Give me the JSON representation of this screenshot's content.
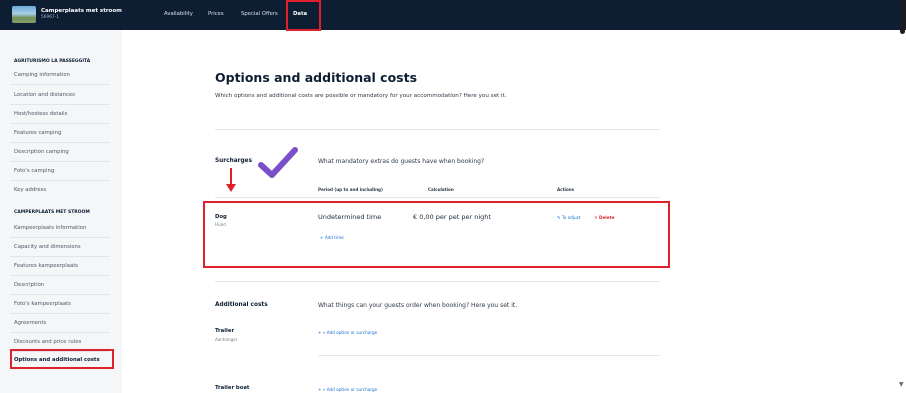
{
  "header": {
    "property_name": "Camperplaats met stroom",
    "property_id": "56967-1",
    "nav": [
      {
        "label": "Availability"
      },
      {
        "label": "Prices"
      },
      {
        "label": "Special Offers"
      },
      {
        "label": "Data",
        "active": true
      }
    ]
  },
  "sidebar": {
    "group1_title": "AGRITURISMO LA PASSEGGITA",
    "group1_items": [
      {
        "label": "Camping information"
      },
      {
        "label": "Location and distances"
      },
      {
        "label": "Host/hostess details"
      },
      {
        "label": "Features camping"
      },
      {
        "label": "Description camping"
      },
      {
        "label": "Foto's camping"
      },
      {
        "label": "Key address"
      }
    ],
    "group2_title": "CAMPERPLAATS MET STROOM",
    "group2_items": [
      {
        "label": "Kampeerplaats information"
      },
      {
        "label": "Capacity and dimensions"
      },
      {
        "label": "Features kampeerplaats"
      },
      {
        "label": "Description"
      },
      {
        "label": "Foto's kampeerplaats"
      },
      {
        "label": "Agreements"
      },
      {
        "label": "Discounts and price rules"
      },
      {
        "label": "Options and additional costs",
        "active": true
      }
    ]
  },
  "main": {
    "title": "Options and additional costs",
    "description": "Which options and additional costs are possible or mandatory for your accommodation? Here you set it.",
    "surcharges": {
      "title": "Surcharges",
      "question": "What mandatory extras do guests have when booking?",
      "columns": [
        "Period (up to and including)",
        "Calculation",
        "Actions"
      ],
      "rows": [
        {
          "name": "Dog",
          "sub": "Hund",
          "period": "Undetermined time",
          "calculation": "€ 0,00 per pet per night",
          "adjust_label": "To adjust",
          "delete_label": "Delete",
          "add_time_label": "+ Add time"
        }
      ]
    },
    "additional_costs": {
      "title": "Additional costs",
      "question": "What things can your guests order when booking? Here you set it.",
      "items": [
        {
          "name": "Trailer",
          "sub": "Aanhanger",
          "add_label": "+ » Add option or surcharge"
        },
        {
          "name": "Trailer boat",
          "add_label": "+ » Add option or surcharge"
        }
      ]
    }
  },
  "colors": {
    "topbar": "#0d1e33",
    "highlight": "#e0202a",
    "link": "#1a6fd1",
    "delete": "#d8242e",
    "checkmark": "#7b4fc9"
  },
  "icons": [
    "checkmark-icon",
    "pencil-icon",
    "close-icon",
    "arrow-down-icon"
  ]
}
